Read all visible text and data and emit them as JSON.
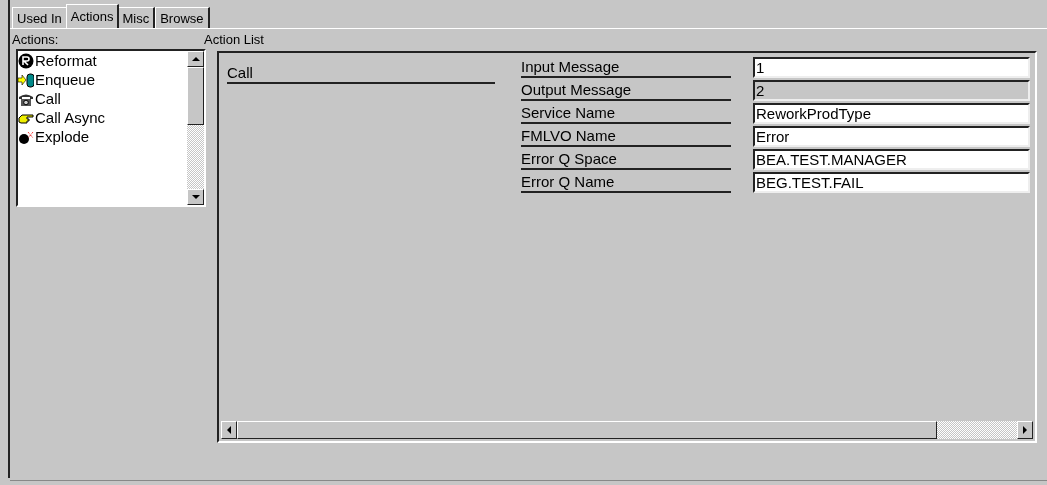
{
  "tabs": [
    {
      "label": "Used In",
      "selected": false
    },
    {
      "label": "Actions",
      "selected": true
    },
    {
      "label": "Misc",
      "selected": false
    },
    {
      "label": "Browse",
      "selected": false
    }
  ],
  "actions_label": "Actions:",
  "action_list_label": "Action List",
  "actions": [
    {
      "label": "Reformat",
      "kind": "reformat"
    },
    {
      "label": "Enqueue",
      "kind": "enqueue"
    },
    {
      "label": "Call",
      "kind": "call"
    },
    {
      "label": "Call Async",
      "kind": "async"
    },
    {
      "label": "Explode",
      "kind": "explode"
    }
  ],
  "action_title": "Call",
  "fields": [
    {
      "label": "Input Message",
      "value": "1",
      "disabled": false
    },
    {
      "label": "Output Message",
      "value": "2",
      "disabled": true
    },
    {
      "label": "Service Name",
      "value": "ReworkProdType",
      "disabled": false
    },
    {
      "label": "FMLVO Name",
      "value": "Error",
      "disabled": false
    },
    {
      "label": "Error Q Space",
      "value": "BEA.TEST.MANAGER",
      "disabled": false
    },
    {
      "label": "Error Q Name",
      "value": "BEG.TEST.FAIL",
      "disabled": false
    }
  ]
}
